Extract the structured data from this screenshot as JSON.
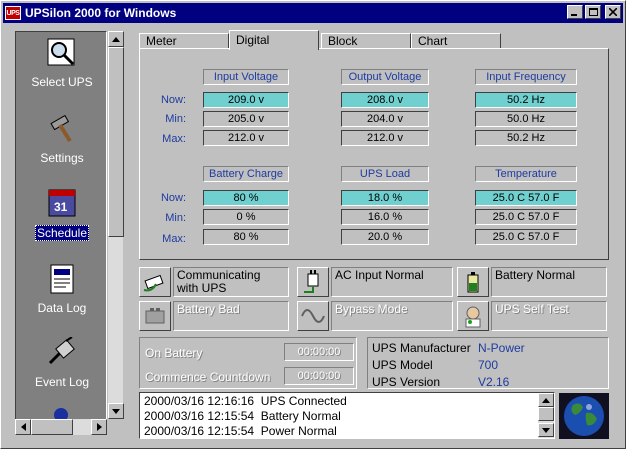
{
  "window": {
    "title": "UPSilon 2000 for Windows",
    "app_icon_text": "UPS"
  },
  "sidebar": {
    "items": [
      {
        "label": "Select UPS",
        "icon": "magnifier-icon"
      },
      {
        "label": "Settings",
        "icon": "hammer-icon"
      },
      {
        "label": "Schedule",
        "icon": "calendar-icon",
        "selected": true,
        "icon_text": "31"
      },
      {
        "label": "Data Log",
        "icon": "document-icon"
      },
      {
        "label": "Event Log",
        "icon": "plug-icon"
      }
    ]
  },
  "tabs": [
    {
      "label": "Meter"
    },
    {
      "label": "Digital",
      "active": true
    },
    {
      "label": "Block"
    },
    {
      "label": "Chart"
    }
  ],
  "digital": {
    "row_labels": {
      "now": "Now:",
      "min": "Min:",
      "max": "Max:"
    },
    "groups": [
      {
        "title": "Input Voltage",
        "now": "209.0 v",
        "min": "205.0 v",
        "max": "212.0 v"
      },
      {
        "title": "Output Voltage",
        "now": "208.0 v",
        "min": "204.0 v",
        "max": "212.0 v"
      },
      {
        "title": "Input Frequency",
        "now": "50.2 Hz",
        "min": "50.0 Hz",
        "max": "50.2 Hz"
      },
      {
        "title": "Battery Charge",
        "now": "80 %",
        "min": "0 %",
        "max": "80 %"
      },
      {
        "title": "UPS Load",
        "now": "18.0 %",
        "min": "16.0 %",
        "max": "20.0 %"
      },
      {
        "title": "Temperature",
        "now": "25.0 C  57.0 F",
        "min": "25.0 C  57.0 F",
        "max": "25.0 C  57.0 F"
      }
    ]
  },
  "status": [
    {
      "text": "Communicating with UPS",
      "icon": "cable-icon",
      "active": true
    },
    {
      "text": "AC Input Normal",
      "icon": "power-plug-icon",
      "active": true
    },
    {
      "text": "Battery Normal",
      "icon": "battery-icon",
      "active": true
    },
    {
      "text": "Battery Bad",
      "icon": "battery-bad-icon",
      "active": false
    },
    {
      "text": "Bypass Mode",
      "icon": "sine-wave-icon",
      "active": false
    },
    {
      "text": "UPS Self Test",
      "icon": "doctor-icon",
      "active": false
    }
  ],
  "battery_info": {
    "on_battery_label": "On Battery",
    "on_battery_time": "00:00:00",
    "countdown_label": "Commence Countdown",
    "countdown_time": "00:00:00"
  },
  "ups_info": {
    "manufacturer_label": "UPS Manufacturer",
    "manufacturer": "N-Power",
    "model_label": "UPS Model",
    "model": "700",
    "version_label": "UPS Version",
    "version": "V2.16"
  },
  "event_log": [
    {
      "time": "2000/03/16 12:16:16",
      "event": "UPS Connected"
    },
    {
      "time": "2000/03/16 12:15:54",
      "event": "Battery Normal"
    },
    {
      "time": "2000/03/16 12:15:54",
      "event": "Power Normal"
    }
  ],
  "colors": {
    "titlebar": "#000080",
    "label_blue": "#1e3ba0",
    "now_highlight": "#70d0d0"
  }
}
